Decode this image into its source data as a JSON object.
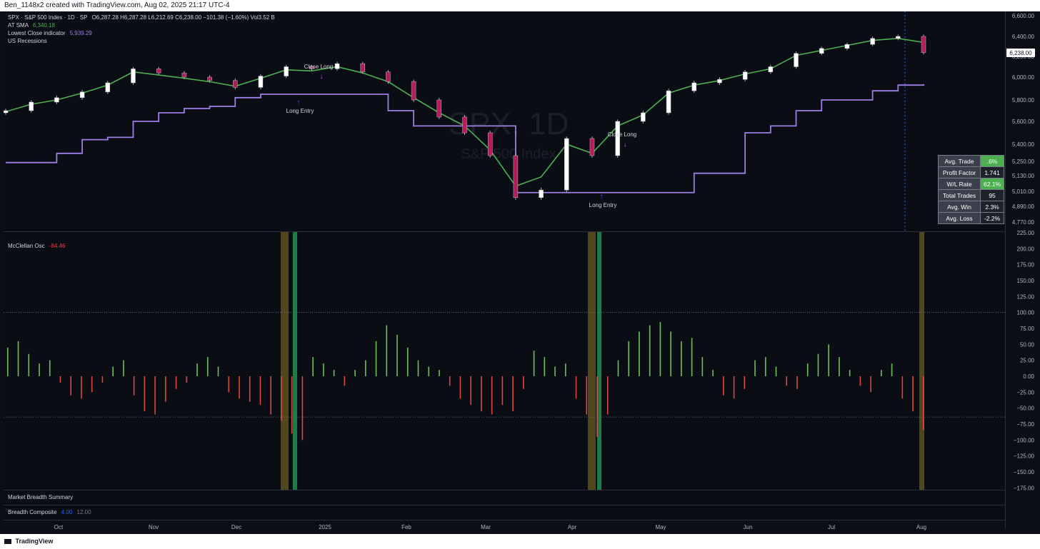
{
  "header": {
    "credit": "Ben_1148x2 created with TradingView.com, Aug 02, 2025 21:17 UTC-4"
  },
  "legend": {
    "symbol": "SPX · S&P 500 Index · 1D · SP",
    "ohlc": "O6,287.28  H6,287.28  L6,212.69  C6,238.00  −101.38 (−1.60%)  Vol3.52 B",
    "sma_label": "AT SMA",
    "sma_value": "6,340.18",
    "lowest_label": "Lowest Close indicator",
    "lowest_value": "5,939.29",
    "recessions_label": "US Recessions"
  },
  "watermark": {
    "ticker": "SPX, 1D",
    "name": "S&P 500 Index"
  },
  "price_axis": {
    "labels": [
      "6,600.00",
      "6,400.00",
      "6,200.00",
      "6,000.00",
      "5,800.00",
      "5,600.00",
      "5,400.00",
      "5,250.00",
      "5,130.00",
      "5,010.00",
      "4,890.00",
      "4,770.00"
    ],
    "current_price": "6,238.00"
  },
  "osc_axis": {
    "labels": [
      "225.00",
      "200.00",
      "175.00",
      "150.00",
      "125.00",
      "100.00",
      "75.00",
      "50.00",
      "25.00",
      "0.00",
      "−25.00",
      "−50.00",
      "−75.00",
      "−100.00",
      "−125.00",
      "−150.00",
      "−175.00"
    ]
  },
  "time_axis": {
    "labels": [
      "Oct",
      "Nov",
      "Dec",
      "2025",
      "Feb",
      "Mar",
      "Apr",
      "May",
      "Jun",
      "Jul",
      "Aug"
    ]
  },
  "annotations": {
    "close_long": "Close Long",
    "long_entry": "Long Entry"
  },
  "stats": [
    {
      "key": "Avg. Trade",
      "value": ".6%"
    },
    {
      "key": "Profit Factor",
      "value": "1.741"
    },
    {
      "key": "W/L Rate",
      "value": "62.1%"
    },
    {
      "key": "Total Trades",
      "value": "95"
    },
    {
      "key": "Avg. Win",
      "value": "2.3%"
    },
    {
      "key": "Avg. Loss",
      "value": "-2.2%"
    }
  ],
  "oscillator": {
    "label": "McClellan Osc",
    "value": "-84.46"
  },
  "summary_label": "Market Breadth Summary",
  "composite": {
    "label": "Breadth Composite",
    "value1": "4.00",
    "value2": "12.00"
  },
  "footer": {
    "brand": "TradingView"
  },
  "colors": {
    "up": "#ffffff",
    "down": "#b71c5a",
    "sma": "#4caf50",
    "lowest_close": "#9c7fe6",
    "osc_pos": "#6fbf5a",
    "osc_neg": "#e0473c",
    "highlight_olive": "#6b5a1e",
    "highlight_green": "#1fa35a",
    "composite_value1": "#2962ff",
    "oscillator_value": "#f23645",
    "sma_value": "#4caf50",
    "lowest_value": "#9c7fe6"
  },
  "chart_data": [
    {
      "type": "line",
      "title": "SPX, 1D",
      "subtitle": "S&P 500 Index",
      "x": [
        "Oct",
        "Nov",
        "Dec",
        "2025",
        "Feb",
        "Mar",
        "Apr",
        "May",
        "Jun",
        "Jul",
        "Aug"
      ],
      "series": [
        {
          "name": "",
          "values": [
            5700,
            5780,
            5820,
            5870,
            5950,
            6080,
            6040,
            6000,
            5970,
            5910,
            6010,
            6100,
            6080,
            6130,
            6050,
            5960,
            5800,
            5640,
            5500,
            5300,
            4960,
            5020,
            5450,
            5300,
            5600,
            5680,
            5880,
            5950,
            5980,
            6050,
            6100,
            6230,
            6280,
            6320,
            6380,
            6400,
            6238
          ]
        },
        {
          "name": "AT SMA",
          "values": [
            5690,
            5760,
            5800,
            5860,
            5930,
            6050,
            6020,
            5990,
            5960,
            5920,
            5990,
            6070,
            6060,
            6100,
            6040,
            5960,
            5820,
            5680,
            5560,
            5350,
            5050,
            5120,
            5400,
            5320,
            5560,
            5660,
            5860,
            5930,
            5970,
            6030,
            6080,
            6210,
            6260,
            6310,
            6360,
            6380,
            6340.18
          ]
        },
        {
          "name": "Lowest Close indicator",
          "values": [
            5240,
            5240,
            5320,
            5440,
            5460,
            5600,
            5680,
            5720,
            5740,
            5820,
            5850,
            5850,
            5850,
            5850,
            5850,
            5700,
            5560,
            5560,
            5560,
            5560,
            5000,
            5000,
            5000,
            5000,
            5000,
            5000,
            5000,
            5150,
            5150,
            5500,
            5560,
            5700,
            5800,
            5800,
            5880,
            5930,
            5939.29
          ]
        }
      ],
      "ylim": [
        4700,
        6650
      ],
      "grid": false,
      "legend": "top-left"
    },
    {
      "type": "bar",
      "title": "McClellan Osc",
      "x": [
        "Oct",
        "Nov",
        "Dec",
        "2025",
        "Feb",
        "Mar",
        "Apr",
        "May",
        "Jun",
        "Jul",
        "Aug"
      ],
      "values": [
        45,
        55,
        35,
        20,
        25,
        -10,
        -30,
        -35,
        -25,
        -10,
        15,
        25,
        -30,
        -55,
        -60,
        -40,
        -20,
        -10,
        20,
        30,
        15,
        -25,
        -35,
        -40,
        -45,
        -60,
        -70,
        -90,
        -100,
        30,
        20,
        10,
        -15,
        10,
        25,
        55,
        80,
        65,
        45,
        25,
        15,
        10,
        -15,
        -35,
        -45,
        -55,
        -60,
        -45,
        -55,
        -20,
        40,
        30,
        15,
        20,
        -35,
        -60,
        -95,
        -60,
        25,
        55,
        70,
        80,
        85,
        70,
        55,
        60,
        30,
        10,
        -30,
        -35,
        -20,
        25,
        30,
        15,
        -15,
        -20,
        20,
        35,
        50,
        30,
        10,
        -15,
        -25,
        10,
        20,
        -35,
        -55,
        -84.46
      ],
      "ylim": [
        -175,
        225
      ],
      "reference_line": 100,
      "grid": false
    },
    {
      "type": "line",
      "title": "Breadth Composite",
      "x": [
        "Oct",
        "Nov",
        "Dec",
        "2025",
        "Feb",
        "Mar",
        "Apr",
        "May",
        "Jun",
        "Jul",
        "Aug"
      ],
      "series": [
        {
          "name": "",
          "values": [
            4.0
          ]
        },
        {
          "name": "",
          "values": [
            12.0
          ]
        }
      ]
    }
  ]
}
